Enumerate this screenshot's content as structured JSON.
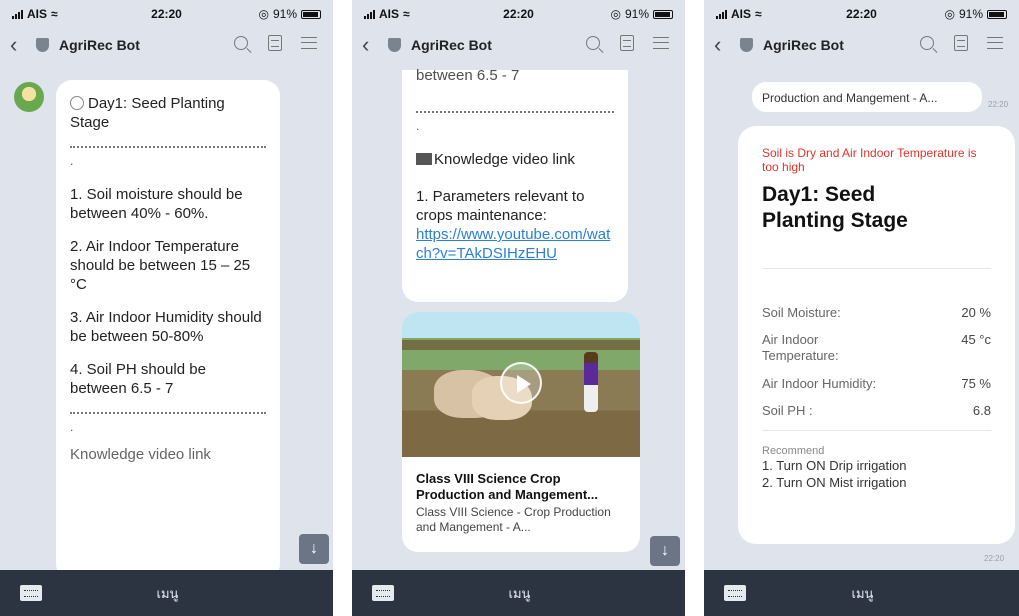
{
  "status": {
    "carrier": "AIS",
    "time": "22:20",
    "battery": "91%"
  },
  "header": {
    "title": "AgriRec Bot"
  },
  "bottom": {
    "menu_label": "เมนู"
  },
  "phone1": {
    "title": "Day1: Seed Planting Stage",
    "items": [
      "1. Soil moisture should be between 40% - 60%.",
      "2. Air Indoor Temperature should be between 15 – 25 °C",
      "3. Air Indoor Humidity should be between 50-80%",
      "4. Soil PH should be between 6.5 - 7"
    ],
    "cut_text": "Knowledge video link"
  },
  "phone2": {
    "top_cut": "between 6.5 - 7",
    "video_heading": "Knowledge video link",
    "param_text": "1. Parameters relevant to crops maintenance:",
    "link": "https://www.youtube.com/watch?v=TAkDSIHzEHU",
    "card_title": "Class VIII Science Crop Production and Mangement...",
    "card_subtitle": "Class VIII Science - Crop Production and Mangement - A..."
  },
  "phone3": {
    "prev_text": "Production and Mangement - A...",
    "prev_time": "22:20",
    "alert": "Soil is Dry and Air Indoor Temperature is too high",
    "title": "Day1: Seed Planting Stage",
    "rows": [
      {
        "label": "Soil Moisture:",
        "value": "20 %"
      },
      {
        "label": "Air Indoor Temperature:",
        "value": "45 °c"
      },
      {
        "label": "Air Indoor Humidity:",
        "value": "75 %"
      },
      {
        "label": "Soil PH :",
        "value": "6.8"
      }
    ],
    "recommend_label": "Recommend",
    "recommend": [
      "1. Turn ON Drip irrigation",
      "2. Turn ON Mist irrigation"
    ],
    "time": "22:20"
  }
}
